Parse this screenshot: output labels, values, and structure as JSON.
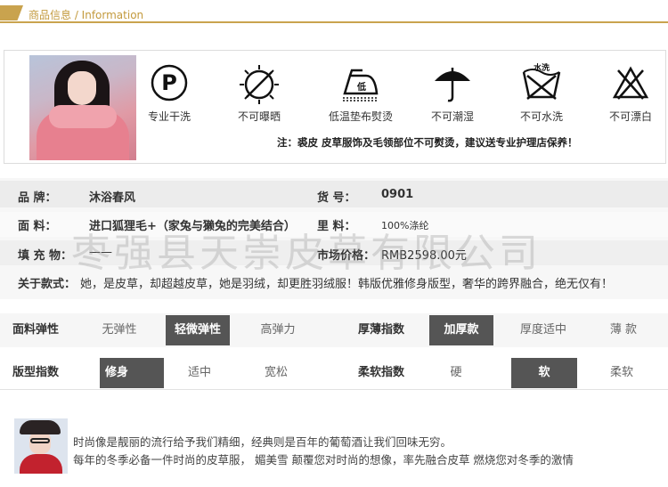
{
  "header": {
    "title": "商品信息 / Information"
  },
  "care": {
    "icons": [
      {
        "icon": "dry-clean-p-icon",
        "label": "专业干洗"
      },
      {
        "icon": "no-sun-dry-icon",
        "label": "不可曝晒"
      },
      {
        "icon": "low-iron-icon",
        "label": "低温垫布熨烫",
        "mark": "低"
      },
      {
        "icon": "no-damp-icon",
        "label": "不可潮湿"
      },
      {
        "icon": "no-wash-icon",
        "label": "不可水洗",
        "mark": "水洗"
      },
      {
        "icon": "no-bleach-icon",
        "label": "不可漂白"
      }
    ],
    "note": "注：裘皮  皮草服饰及毛领部位不可熨烫，建议送专业护理店保养！"
  },
  "product": {
    "brand_label": "品    牌：",
    "brand_value": "沐浴春风",
    "code_label": "货    号：",
    "code_value": "0901",
    "fabric_label": "面    料：",
    "fabric_value": "进口狐狸毛+（家兔与獭兔的完美结合）",
    "lining_label": "里    料：",
    "lining_value": "100%涤纶",
    "filling_label": "填 充 物：",
    "filling_value": "——",
    "price_label": "市场价格：",
    "price_value": "RMB2598.00元",
    "about_label": "关于款式：",
    "about_value": "她，是皮草，却超越皮草，她是羽绒，却更胜羽绒服！韩版优雅修身版型，奢华的跨界融合，绝无仅有！"
  },
  "watermark": "枣强县天崇皮草有限公司",
  "specs": {
    "elasticity": {
      "label": "面料弹性",
      "options": [
        "无弹性",
        "轻微弹性",
        "高弹力"
      ],
      "selected": "轻微弹性"
    },
    "thickness": {
      "label": "厚薄指数",
      "options": [
        "加厚款",
        "厚度适中",
        "薄  款"
      ],
      "selected": "加厚款"
    },
    "fit": {
      "label": "版型指数",
      "options": [
        "修身",
        "适中",
        "宽松"
      ],
      "selected": "修身"
    },
    "softness": {
      "label": "柔软指数",
      "options": [
        "硬",
        "软",
        "柔软"
      ],
      "selected": "软"
    }
  },
  "promo": {
    "line1": "时尚像是靓丽的流行给予我们精细，经典则是百年的葡萄酒让我们回味无穷。",
    "line2": "每年的冬季必备一件时尚的皮草服，  媚美雪  颠覆您对时尚的想像，率先融合皮草  燃烧您对冬季的激情"
  }
}
